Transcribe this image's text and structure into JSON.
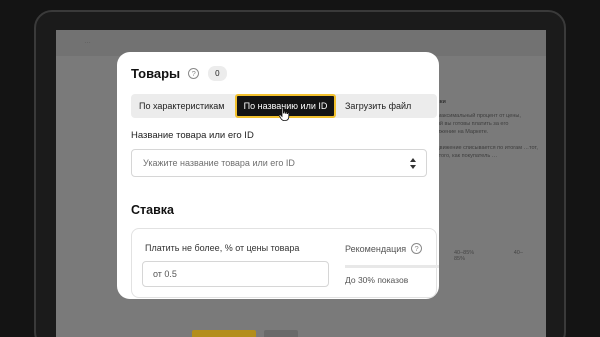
{
  "background": {
    "topbar_text": "…",
    "side_heading": "…ставки",
    "side_paragraph_1": "…это максимальный процент от цены, который вы готовы платить за его продвижение на Маркете.",
    "side_paragraph_2": "…продвижение списывается по итогам …тот, после того, как покупатель …",
    "side_link": "…",
    "stat_1": "40–85%",
    "stat_2": "40–85%"
  },
  "modal": {
    "title": "Товары",
    "help_icon_glyph": "?",
    "count": "0",
    "tabs": [
      {
        "label": "По характеристикам",
        "active": false
      },
      {
        "label": "По названию или ID",
        "active": true
      },
      {
        "label": "Загрузить файл",
        "active": false
      }
    ],
    "field_label": "Название товара или его ID",
    "select_placeholder": "Укажите название товара или его ID",
    "bid_section_title": "Ставка",
    "bid_label": "Платить не более, % от цены товара",
    "bid_input_value": "от 0.5",
    "recommendation_label": "Рекомендация",
    "recommendation_value": "До 30% показов"
  },
  "colors": {
    "accent": "#f2c12e",
    "active_tab_bg": "#141414"
  }
}
